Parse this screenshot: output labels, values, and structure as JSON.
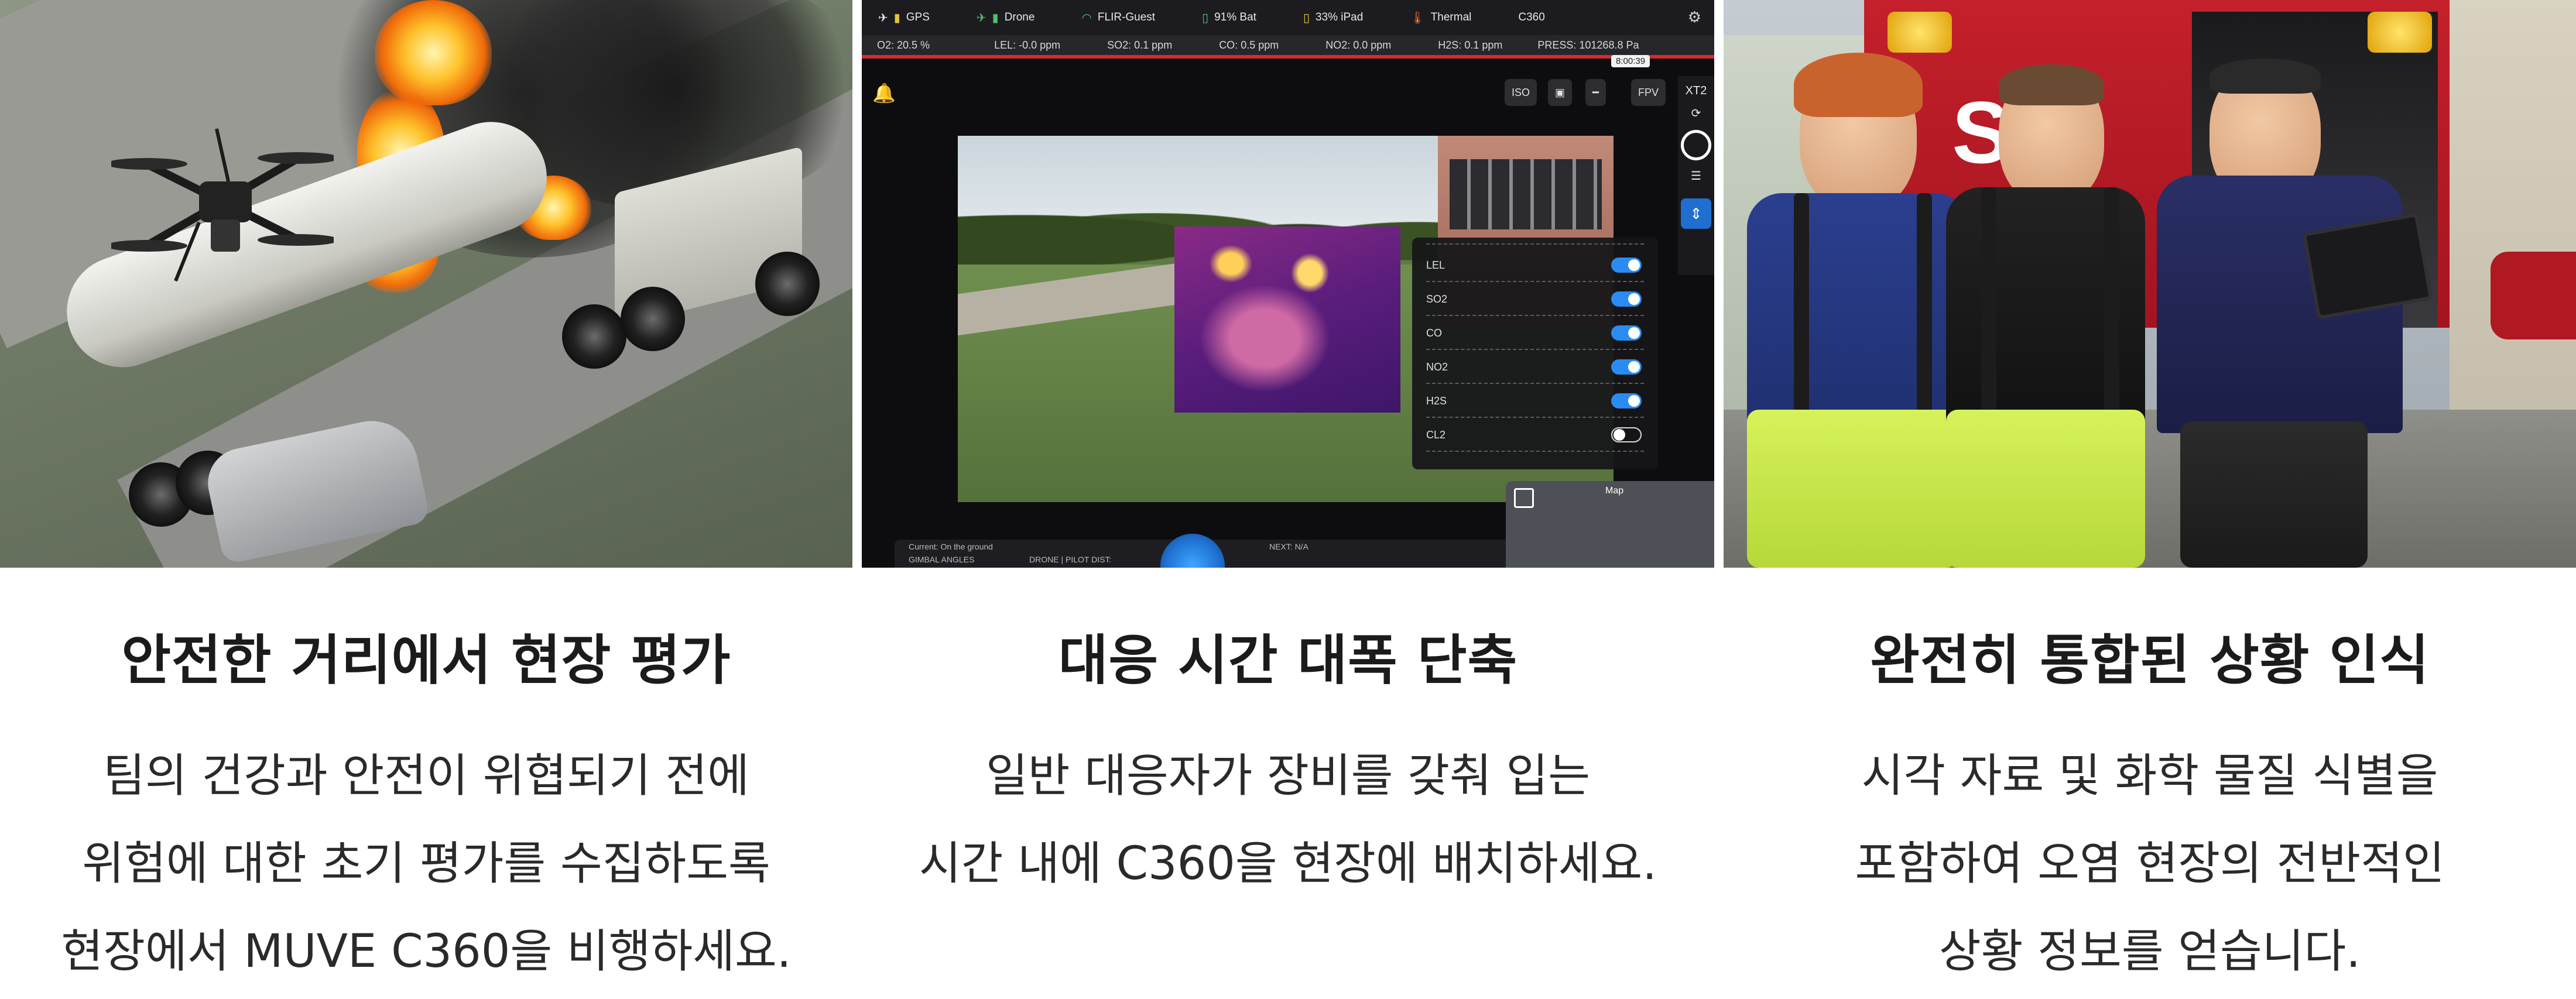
{
  "panels": [
    {
      "heading": "안전한 거리에서 현장 평가",
      "lines": [
        "팀의 건강과 안전이 위협되기 전에",
        "위험에 대한 초기 평가를 수집하도록",
        "현장에서 MUVE C360을 비행하세요."
      ]
    },
    {
      "heading": "대응 시간 대폭 단축",
      "lines": [
        "일반 대응자가 장비를 갖춰 입는",
        "시간 내에 C360을 현장에 배치하세요."
      ]
    },
    {
      "heading": "완전히 통합된 상황 인식",
      "lines": [
        "시각 자료 및 화학 물질 식별을",
        "포함하여 오염 현장의 전반적인",
        "상황 정보를 얻습니다."
      ]
    }
  ],
  "tablet_ui": {
    "topbar": {
      "gps": "GPS",
      "drone": "Drone",
      "wifi": "FLIR-Guest",
      "battery": "91% Bat",
      "ipad": "33% iPad",
      "thermal": "Thermal",
      "device": "C360"
    },
    "sensors": {
      "o2": "O2:  20.5  %",
      "lel": "LEL:  -0.0  ppm",
      "so2": "SO2:  0.1  ppm",
      "co": "CO:  0.5  ppm",
      "no2": "NO2:  0.0  ppm",
      "h2s": "H2S:  0.1  ppm",
      "press": "PRESS:  101268.8  Pa"
    },
    "timer": "8:00:39",
    "controls": {
      "iso": "ISO",
      "fpv": "FPV",
      "xt2": "XT2"
    },
    "gas_toggles": [
      {
        "label": "LEL",
        "on": true
      },
      {
        "label": "SO2",
        "on": true
      },
      {
        "label": "CO",
        "on": true
      },
      {
        "label": "NO2",
        "on": true
      },
      {
        "label": "H2S",
        "on": true
      },
      {
        "label": "CL2",
        "on": false
      }
    ],
    "bottom": {
      "current": "Current: On the ground",
      "gimbal": "GIMBAL ANGLES",
      "dist": "DRONE | PILOT DIST:",
      "next": "NEXT: N/A"
    },
    "map_label": "Map"
  },
  "photo3": {
    "engine_lettering": "ST."
  },
  "icons": {
    "drone": "drone-icon",
    "signal": "signal-bars-icon",
    "wifi": "wifi-icon",
    "battery": "battery-icon",
    "thermometer": "thermometer-icon",
    "gear": "gear-icon",
    "bell": "bell-icon"
  },
  "colors": {
    "toggle_on": "#2a8cf0",
    "alert_bar": "#d62b2b",
    "thermal": "#7a2488"
  }
}
